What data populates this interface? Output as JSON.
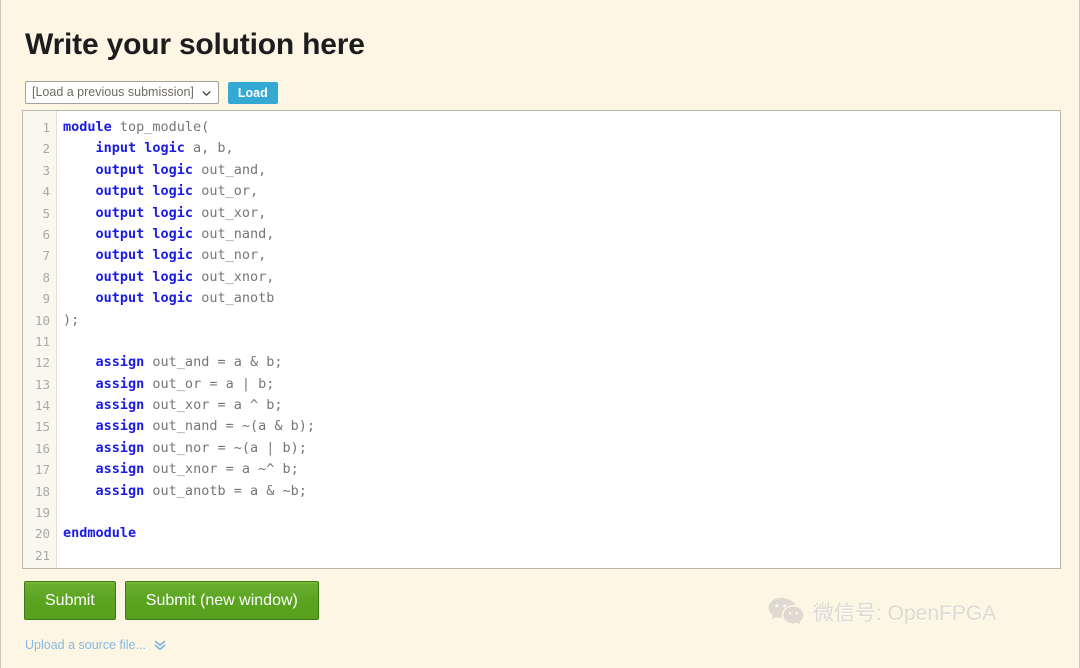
{
  "page": {
    "title": "Write your solution here",
    "background_color": "#fdf6e4"
  },
  "load_row": {
    "select_value": "[Load a previous submission]",
    "select_icon": "chevron-down-icon",
    "load_label": "Load",
    "load_color": "#33a9d4"
  },
  "editor": {
    "line_numbers": [
      1,
      2,
      3,
      4,
      5,
      6,
      7,
      8,
      9,
      10,
      11,
      12,
      13,
      14,
      15,
      16,
      17,
      18,
      19,
      20,
      21
    ],
    "keyword_color": "#1a1ae6",
    "text_color": "#767676",
    "lines": [
      {
        "n": 1,
        "parts": [
          {
            "t": "module",
            "k": true
          },
          {
            "t": " top_module(",
            "k": false
          }
        ]
      },
      {
        "n": 2,
        "parts": [
          {
            "t": "    ",
            "k": false
          },
          {
            "t": "input logic",
            "k": true
          },
          {
            "t": " a, b,",
            "k": false
          }
        ]
      },
      {
        "n": 3,
        "parts": [
          {
            "t": "    ",
            "k": false
          },
          {
            "t": "output logic",
            "k": true
          },
          {
            "t": " out_and,",
            "k": false
          }
        ]
      },
      {
        "n": 4,
        "parts": [
          {
            "t": "    ",
            "k": false
          },
          {
            "t": "output logic",
            "k": true
          },
          {
            "t": " out_or,",
            "k": false
          }
        ]
      },
      {
        "n": 5,
        "parts": [
          {
            "t": "    ",
            "k": false
          },
          {
            "t": "output logic",
            "k": true
          },
          {
            "t": " out_xor,",
            "k": false
          }
        ]
      },
      {
        "n": 6,
        "parts": [
          {
            "t": "    ",
            "k": false
          },
          {
            "t": "output logic",
            "k": true
          },
          {
            "t": " out_nand,",
            "k": false
          }
        ]
      },
      {
        "n": 7,
        "parts": [
          {
            "t": "    ",
            "k": false
          },
          {
            "t": "output logic",
            "k": true
          },
          {
            "t": " out_nor,",
            "k": false
          }
        ]
      },
      {
        "n": 8,
        "parts": [
          {
            "t": "    ",
            "k": false
          },
          {
            "t": "output logic",
            "k": true
          },
          {
            "t": " out_xnor,",
            "k": false
          }
        ]
      },
      {
        "n": 9,
        "parts": [
          {
            "t": "    ",
            "k": false
          },
          {
            "t": "output logic",
            "k": true
          },
          {
            "t": " out_anotb",
            "k": false
          }
        ]
      },
      {
        "n": 10,
        "parts": [
          {
            "t": ");",
            "k": false
          }
        ]
      },
      {
        "n": 11,
        "parts": [
          {
            "t": "",
            "k": false
          }
        ]
      },
      {
        "n": 12,
        "parts": [
          {
            "t": "    ",
            "k": false
          },
          {
            "t": "assign",
            "k": true
          },
          {
            "t": " out_and = a & b;",
            "k": false
          }
        ]
      },
      {
        "n": 13,
        "parts": [
          {
            "t": "    ",
            "k": false
          },
          {
            "t": "assign",
            "k": true
          },
          {
            "t": " out_or = a | b;",
            "k": false
          }
        ]
      },
      {
        "n": 14,
        "parts": [
          {
            "t": "    ",
            "k": false
          },
          {
            "t": "assign",
            "k": true
          },
          {
            "t": " out_xor = a ^ b;",
            "k": false
          }
        ]
      },
      {
        "n": 15,
        "parts": [
          {
            "t": "    ",
            "k": false
          },
          {
            "t": "assign",
            "k": true
          },
          {
            "t": " out_nand = ~(a & b);",
            "k": false
          }
        ]
      },
      {
        "n": 16,
        "parts": [
          {
            "t": "    ",
            "k": false
          },
          {
            "t": "assign",
            "k": true
          },
          {
            "t": " out_nor = ~(a | b);",
            "k": false
          }
        ]
      },
      {
        "n": 17,
        "parts": [
          {
            "t": "    ",
            "k": false
          },
          {
            "t": "assign",
            "k": true
          },
          {
            "t": " out_xnor = a ~^ b;",
            "k": false
          }
        ]
      },
      {
        "n": 18,
        "parts": [
          {
            "t": "    ",
            "k": false
          },
          {
            "t": "assign",
            "k": true
          },
          {
            "t": " out_anotb = a & ~b;",
            "k": false
          }
        ]
      },
      {
        "n": 19,
        "parts": [
          {
            "t": "",
            "k": false
          }
        ]
      },
      {
        "n": 20,
        "parts": [
          {
            "t": "endmodule",
            "k": true
          }
        ]
      },
      {
        "n": 21,
        "parts": [
          {
            "t": "",
            "k": false
          }
        ]
      }
    ]
  },
  "buttons": {
    "submit_label": "Submit",
    "submit_new_window_label": "Submit (new window)",
    "green_color": "#5aa420"
  },
  "upload": {
    "label": "Upload a source file...",
    "icon": "double-chevron-down-icon",
    "color": "#86b9dd"
  },
  "watermark": {
    "logo": "wechat-logo",
    "text": "微信号: OpenFPGA",
    "color": "#ddd9d0"
  }
}
